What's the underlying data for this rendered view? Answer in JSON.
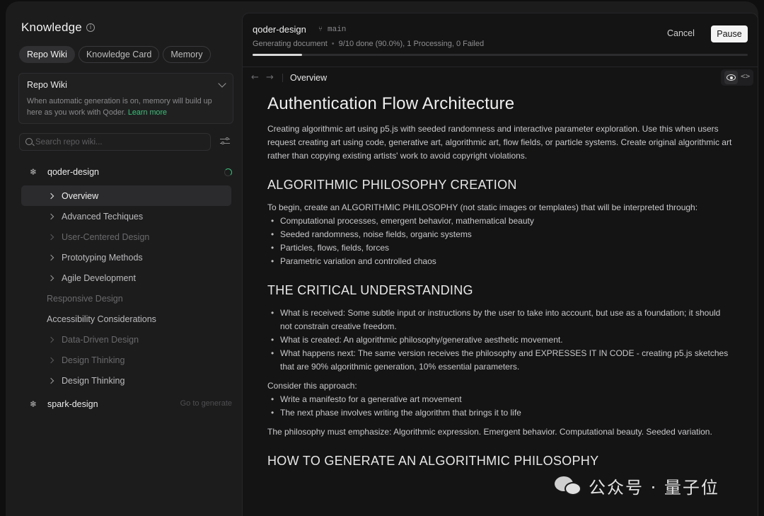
{
  "sidebar": {
    "title": "Knowledge",
    "info_icon": "info-icon",
    "tabs": [
      "Repo Wiki",
      "Knowledge Card",
      "Memory"
    ],
    "active_tab": "Repo Wiki",
    "repo_card": {
      "title": "Repo Wiki",
      "description": "When automatic generation is on, memory will  build up here as you work with Qoder. ",
      "link": "Learn more"
    },
    "search_placeholder": "Search repo wiki...",
    "projects": [
      {
        "name": "qoder-design",
        "status": "processing",
        "items": [
          "Overview",
          "Advanced Techiques",
          "User-Centered Design",
          "Prototyping Methods",
          "Agile Development",
          "Responsive Design",
          "Accessibility Considerations",
          "Data-Driven Design",
          "Design Thinking",
          "Design Thinking"
        ]
      },
      {
        "name": "spark-design",
        "action": "Go to generate"
      }
    ]
  },
  "main": {
    "project": "qoder-design",
    "branch": "main",
    "status_label": "Generating document",
    "status_detail": "9/10 done (90.0%), 1 Processing, 0 Failed",
    "progress": 0.1,
    "cancel_label": "Cancel",
    "pause_label": "Pause",
    "breadcrumb": "Overview",
    "doc": {
      "title": "Authentication Flow Architecture",
      "intro": "Creating algorithmic art using p5.js with seeded randomness and interactive parameter exploration. Use this when users request creating art using code, generative art, algorithmic art, flow fields, or particle systems. Create original algorithmic art rather than copying existing artists' work to avoid copyright violations.",
      "s1_heading": "ALGORITHMIC PHILOSOPHY CREATION",
      "s1_text": "To begin, create an ALGORITHMIC PHILOSOPHY (not static images or templates) that will be interpreted through:",
      "s1_list": [
        "Computational processes, emergent behavior, mathematical beauty",
        "Seeded randomness, noise fields, organic systems",
        "Particles, flows, fields, forces",
        "Parametric variation and controlled chaos"
      ],
      "s2_heading": "THE CRITICAL UNDERSTANDING",
      "s2_list": [
        "What is received: Some subtle input or instructions by the user to take into account, but use as a foundation; it should not constrain creative freedom.",
        "What is created: An algorithmic philosophy/generative aesthetic movement.",
        "What happens next: The same version receives the philosophy and EXPRESSES IT IN CODE - creating p5.js sketches that are 90% algorithmic generation, 10% essential parameters."
      ],
      "s2_consider": "Consider this approach:",
      "s2_list2": [
        "Write a manifesto for a generative art movement",
        "The next phase involves writing the algorithm that brings it to life"
      ],
      "s2_emphasis": "The philosophy must emphasize: Algorithmic expression. Emergent behavior. Computational beauty. Seeded variation.",
      "s3_heading": "HOW TO GENERATE AN ALGORITHMIC PHILOSOPHY"
    }
  },
  "watermark": "公众号 · 量子位"
}
